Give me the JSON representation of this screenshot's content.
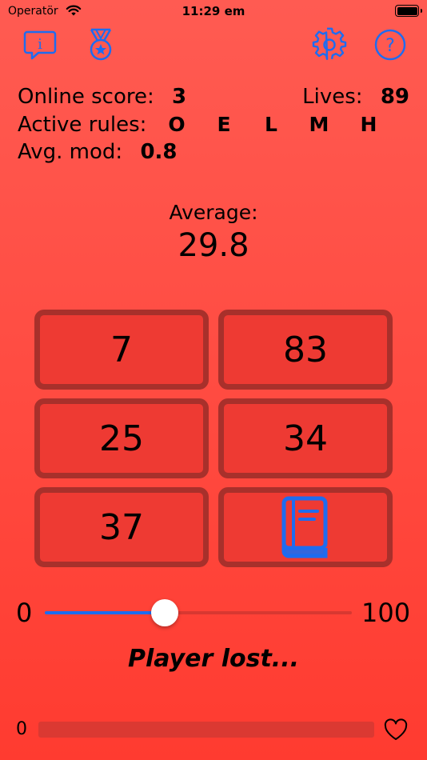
{
  "status_bar": {
    "carrier": "Operatör",
    "time": "11:29 em"
  },
  "toolbar": {
    "left_icons": [
      "info-bubble-icon",
      "medal-icon"
    ],
    "right_icons": [
      "gear-icon",
      "help-icon"
    ],
    "icon_color": "#1e6cf0"
  },
  "stats": {
    "online_score_label": "Online score:",
    "online_score_value": "3",
    "lives_label": "Lives:",
    "lives_value": "89",
    "active_rules_label": "Active rules:",
    "active_rules": [
      "O",
      "E",
      "L",
      "M",
      "H"
    ],
    "avg_mod_label": "Avg. mod:",
    "avg_mod_value": "0.8"
  },
  "average": {
    "label": "Average:",
    "value": "29.8"
  },
  "cards": [
    "7",
    "83",
    "25",
    "34",
    "37",
    "book-icon"
  ],
  "slider": {
    "min_label": "0",
    "max_label": "100",
    "value": 39
  },
  "result_text": "Player lost...",
  "lives_bar": {
    "min_label": "0",
    "fill_fraction": 0,
    "icon": "heart-icon"
  },
  "colors": {
    "background": "#ff4a40",
    "card_border": "#a8302b",
    "accent": "#1e6cf0"
  }
}
